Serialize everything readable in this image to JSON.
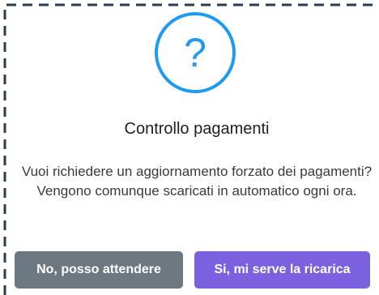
{
  "dialog": {
    "icon": "question-circle-icon",
    "title": "Controllo pagamenti",
    "message": "Vuoi richiedere un aggiornamento forzato dei pagamenti? Vengono comunque scaricati in automatico ogni ora.",
    "buttons": {
      "cancel_label": "No, posso attendere",
      "confirm_label": "Si, mi serve la ricarica"
    }
  },
  "colors": {
    "icon": "#1e9bf0",
    "cancel_button": "#6e7881",
    "confirm_button": "#7b61e0",
    "border": "#2b3b4f"
  }
}
